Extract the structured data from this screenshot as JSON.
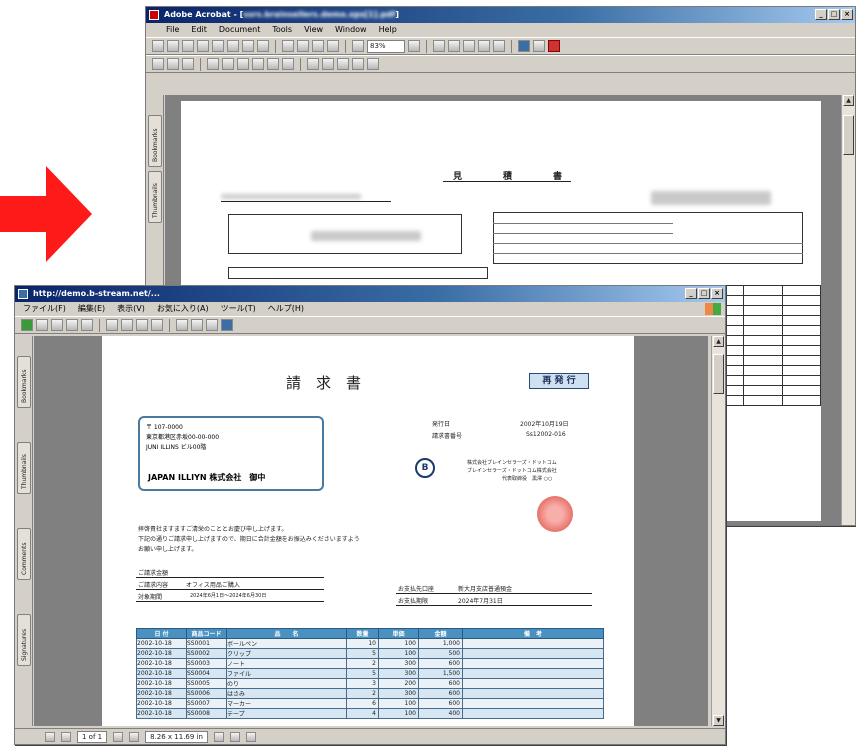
{
  "colors": {
    "arrow": "#ff1a1a",
    "acrobat_title": "#0a246a",
    "invoice_table_header": "#4a90c0",
    "stamp": "#e25a50"
  },
  "back_window": {
    "title": "Adobe Acrobat - [",
    "title_blurred": "ssrs.brainsellers.demo.xps[1].pdf",
    "menu": [
      "File",
      "Edit",
      "Document",
      "Tools",
      "View",
      "Window",
      "Help"
    ],
    "zoom": "83%",
    "side_tabs": [
      "Bookmarks",
      "Thumbnails"
    ],
    "page_title": [
      "見",
      "積",
      "書"
    ]
  },
  "front_window": {
    "title": "http://demo.b-stream.net/...",
    "menu": [
      "ファイル(F)",
      "編集(E)",
      "表示(V)",
      "お気に入り(A)",
      "ツール(T)",
      "ヘルプ(H)"
    ],
    "side_tabs": [
      "Bookmarks",
      "Thumbnails",
      "Comments",
      "Signatures"
    ],
    "status": {
      "page_of": "1 of 1",
      "page_size": "8.26 x 11.69 in"
    }
  },
  "invoice": {
    "title": "請　求　書",
    "reissue_label": "再 発 行",
    "postal": "〒 107-0000",
    "address_line1": "東京都港区赤坂00-00-000",
    "address_line2": "JUNI ILLINS ビル00階",
    "recipient": "JAPAN ILLIYN  株式会社　御中",
    "date_label": "発行日",
    "date_value": "2002年10月19日",
    "invoice_no_label": "請求書番号",
    "invoice_no_value": "Ss12002-016",
    "circle_mark": "B",
    "issuer_line1": "株式会社ブレインセラーズ・ドットコム",
    "issuer_line2": "ブレインセラーズ・ドットコム株式会社",
    "issuer_line3": "代表取締役　黒澤 ○○",
    "greeting_line1": "拝啓貴社ますますご清栄のこととお慶び申し上げます。",
    "greeting_line2": "下記の通りご請求申し上げますので、期日に合計金額をお振込みくださいますよう",
    "greeting_line3": "お願い申し上げます。",
    "field_amount": "ご請求金額",
    "field_content_label": "ご請求内容",
    "field_content_value": "オフィス用品ご購入",
    "field_period_label": "対象期間",
    "field_period_value": "2024年6月1日〜2024年6月30日",
    "field_account_label": "お支払先口座",
    "field_account_value": "新大月支店普通預金",
    "field_due_label": "お支払期限",
    "field_due_value": "2024年7月31日",
    "table_headers": [
      "日 付",
      "商品コード",
      "品　　名",
      "数量",
      "単価",
      "金額",
      "備　考"
    ],
    "table_rows": [
      {
        "date": "2002-10-18",
        "code": "SS0001",
        "name": "ボールペン",
        "qty": "10",
        "price": "100",
        "amount": "1,000"
      },
      {
        "date": "2002-10-18",
        "code": "SS0002",
        "name": "クリップ",
        "qty": "5",
        "price": "100",
        "amount": "500"
      },
      {
        "date": "2002-10-18",
        "code": "SS0003",
        "name": "ノート",
        "qty": "2",
        "price": "300",
        "amount": "600"
      },
      {
        "date": "2002-10-18",
        "code": "SS0004",
        "name": "ファイル",
        "qty": "5",
        "price": "300",
        "amount": "1,500"
      },
      {
        "date": "2002-10-18",
        "code": "SS0005",
        "name": "のり",
        "qty": "3",
        "price": "200",
        "amount": "600"
      },
      {
        "date": "2002-10-18",
        "code": "SS0006",
        "name": "はさみ",
        "qty": "2",
        "price": "300",
        "amount": "600"
      },
      {
        "date": "2002-10-18",
        "code": "SS0007",
        "name": "マーカー",
        "qty": "6",
        "price": "100",
        "amount": "600"
      },
      {
        "date": "2002-10-18",
        "code": "SS0008",
        "name": "テープ",
        "qty": "4",
        "price": "100",
        "amount": "400"
      }
    ]
  }
}
